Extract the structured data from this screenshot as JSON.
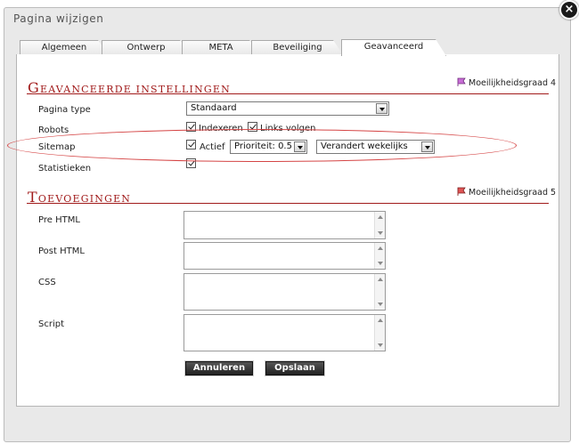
{
  "dialog": {
    "title": "Pagina wijzigen",
    "close_glyph": "×"
  },
  "tabs": [
    {
      "label": "Algemeen"
    },
    {
      "label": "Ontwerp"
    },
    {
      "label": "META"
    },
    {
      "label": "Beveiliging"
    },
    {
      "label": "Geavanceerd",
      "active": true
    }
  ],
  "advanced": {
    "title_first": "G",
    "title_rest": "EAVANCEERDE INSTELLINGEN",
    "difficulty": "Moeilijkheidsgraad 4",
    "difficulty_icon": "flag-icon",
    "page_type": {
      "label": "Pagina type",
      "value": "Standaard"
    },
    "robots": {
      "label": "Robots",
      "index": {
        "label": "Indexeren",
        "checked": true
      },
      "follow": {
        "label": "Links volgen",
        "checked": true
      }
    },
    "sitemap": {
      "label": "Sitemap",
      "active": {
        "label": "Actief",
        "checked": true
      },
      "priority": "Prioriteit: 0.5",
      "frequency": "Verandert wekelijks"
    },
    "statistics": {
      "label": "Statistieken",
      "checked": true
    }
  },
  "additions": {
    "title_first": "T",
    "title_rest": "OEVOEGINGEN",
    "difficulty": "Moeilijkheidsgraad 5",
    "difficulty_icon": "flag-icon",
    "pre_html": {
      "label": "Pre HTML",
      "value": ""
    },
    "post_html": {
      "label": "Post HTML",
      "value": ""
    },
    "css": {
      "label": "CSS",
      "value": ""
    },
    "script": {
      "label": "Script",
      "value": ""
    }
  },
  "buttons": {
    "cancel": "Annuleren",
    "save": "Opslaan"
  },
  "colors": {
    "section_title": "#a11b1b",
    "highlight_ellipse": "#d54545"
  }
}
